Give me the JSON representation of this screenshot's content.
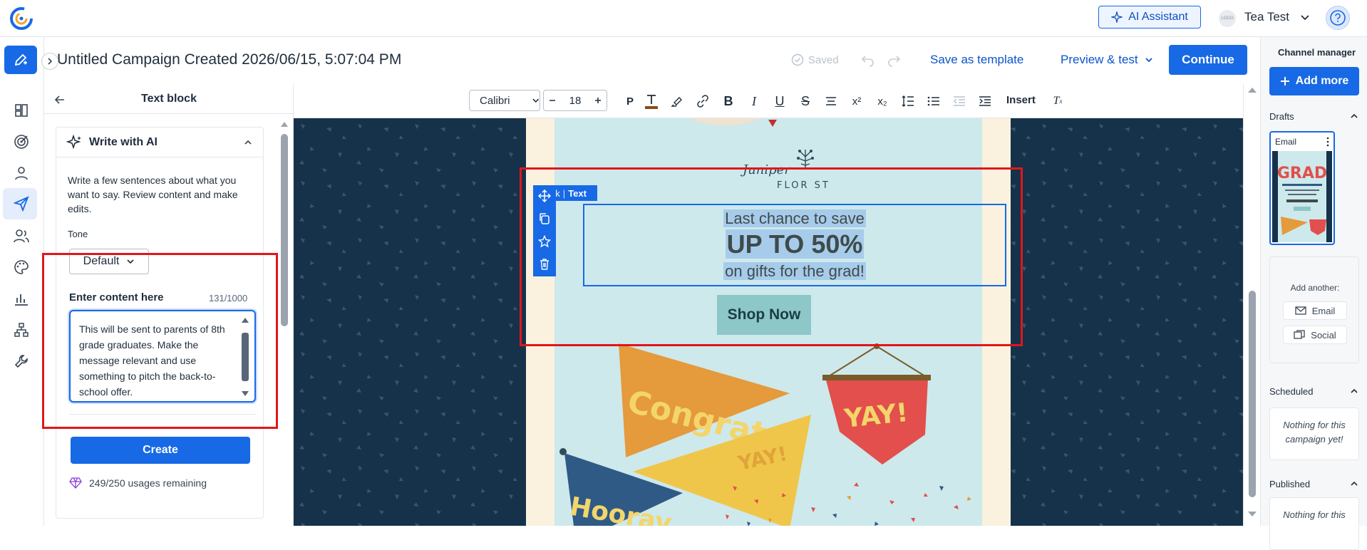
{
  "topbar": {
    "ai_assistant": "AI Assistant",
    "account_logo": "LOGO",
    "account_name": "Tea Test"
  },
  "campaign": {
    "title": "Untitled Campaign Created 2026/06/15, 5:07:04 PM",
    "saved": "Saved",
    "save_as_template": "Save as template",
    "preview_test": "Preview & test",
    "continue": "Continue"
  },
  "rail": {
    "icons": [
      "edit-icon",
      "dashboard-icon",
      "target-icon",
      "contact-icon",
      "send-icon",
      "contacts-icon",
      "palette-icon",
      "reports-icon",
      "integrations-icon",
      "tools-icon"
    ]
  },
  "panel": {
    "title": "Text block",
    "ai_title": "Write with AI",
    "ai_description": "Write a few sentences about what you want to say. Review content and make edits.",
    "tone_label": "Tone",
    "tone_value": "Default",
    "content_label": "Enter content here",
    "content_count": "131/1000",
    "content_text": "This will be sent to parents of 8th grade graduates. Make the message relevant and use something to pitch the back-to-school offer.",
    "create_label": "Create",
    "usage": "249/250 usages remaining"
  },
  "toolbar": {
    "font": "Calibri",
    "size": "18",
    "paragraph": "P",
    "insert": "Insert"
  },
  "email": {
    "logo_name": "Juniper",
    "logo_sub": "FLOR  ST",
    "line1": "Last chance to save",
    "line2": "UP TO 50%",
    "line3": "on gifts for the grad!",
    "block_tag": "Block",
    "block_type": "Text",
    "shop_now": "Shop Now",
    "pennant_congrats": "Congrats",
    "pennant_yay1": "YAY!",
    "pennant_yay2": "YAY!",
    "pennant_hooray": "Hooray"
  },
  "channel": {
    "title": "Channel manager",
    "add_more": "Add more",
    "drafts": "Drafts",
    "email_card": "Email",
    "add_another": "Add another:",
    "add_email": "Email",
    "add_social": "Social",
    "scheduled": "Scheduled",
    "scheduled_empty": "Nothing for this campaign yet!",
    "published": "Published",
    "published_empty": "Nothing for this"
  },
  "colors": {
    "accent": "#1769e6",
    "canvas_bg": "#15324a",
    "email_bg": "#cde9ec",
    "highlight_box": "#e1161b"
  }
}
